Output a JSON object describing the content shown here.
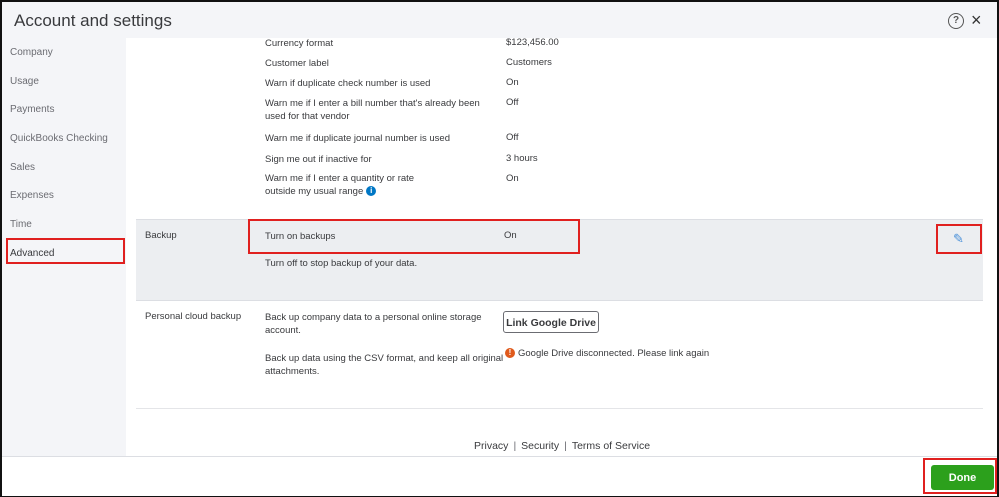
{
  "window": {
    "title": "Account and settings",
    "help_icon": "?",
    "close_icon": "×"
  },
  "sidebar": {
    "items": [
      {
        "label": "Company"
      },
      {
        "label": "Usage"
      },
      {
        "label": "Payments"
      },
      {
        "label": "QuickBooks Checking"
      },
      {
        "label": "Sales"
      },
      {
        "label": "Expenses"
      },
      {
        "label": "Time"
      },
      {
        "label": "Advanced",
        "active": true
      }
    ]
  },
  "other_prefs": {
    "rows": [
      {
        "label": "Currency format",
        "value": "$123,456.00"
      },
      {
        "label": "Customer label",
        "value": "Customers"
      },
      {
        "label": "Warn if duplicate check number is used",
        "value": "On"
      },
      {
        "label_line1": "Warn me if I enter a bill number that's already been",
        "label_line2": "used for that vendor",
        "value": "Off"
      },
      {
        "label": "Warn me if duplicate journal number is used",
        "value": "Off"
      },
      {
        "label": "Sign me out if inactive for",
        "value": "3 hours"
      },
      {
        "label_line1": "Warn me if I enter a quantity or rate",
        "label_line2": "outside my usual range",
        "value": "On"
      }
    ]
  },
  "backup": {
    "section_label": "Backup",
    "toggle_label": "Turn on backups",
    "toggle_value": "On",
    "hint": "Turn off to stop backup of your data."
  },
  "cloud_backup": {
    "section_label": "Personal cloud backup",
    "desc1_line1": "Back up company data to a personal online storage",
    "desc1_line2": "account.",
    "desc2_line1": "Back up data using the CSV format, and keep all original",
    "desc2_line2": "attachments.",
    "link_button": "Link Google Drive",
    "status_text": "Google Drive disconnected. Please link again"
  },
  "footer": {
    "links": [
      "Privacy",
      "Security",
      "Terms of Service"
    ],
    "separator": "|"
  },
  "actions": {
    "done_label": "Done"
  },
  "colors": {
    "primary_green": "#2ca01c",
    "highlight_red": "#e0201f",
    "info_blue": "#0077c5",
    "warning_orange": "#e05a1c"
  }
}
